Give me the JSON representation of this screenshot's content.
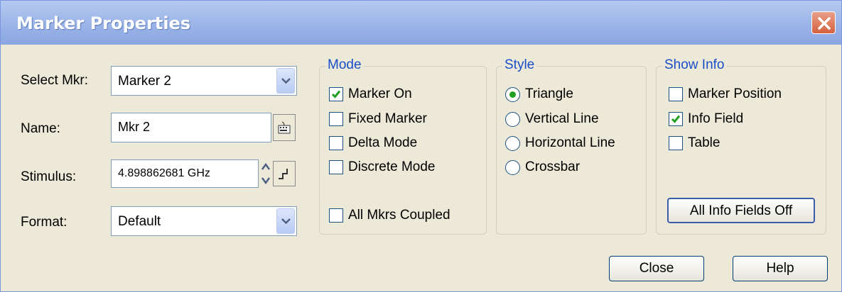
{
  "window": {
    "title": "Marker Properties"
  },
  "fields": {
    "select_mkr": {
      "label": "Select Mkr:",
      "value": "Marker 2"
    },
    "name": {
      "label": "Name:",
      "value": "Mkr 2"
    },
    "stimulus": {
      "label": "Stimulus:",
      "value": "4.898862681 GHz"
    },
    "format": {
      "label": "Format:",
      "value": "Default"
    }
  },
  "mode": {
    "legend": "Mode",
    "items": [
      {
        "label": "Marker On",
        "checked": true
      },
      {
        "label": "Fixed Marker",
        "checked": false
      },
      {
        "label": "Delta Mode",
        "checked": false
      },
      {
        "label": "Discrete Mode",
        "checked": false
      }
    ],
    "coupled": {
      "label": "All Mkrs Coupled",
      "checked": false
    }
  },
  "style": {
    "legend": "Style",
    "items": [
      {
        "label": "Triangle",
        "selected": true
      },
      {
        "label": "Vertical Line",
        "selected": false
      },
      {
        "label": "Horizontal Line",
        "selected": false
      },
      {
        "label": "Crossbar",
        "selected": false
      }
    ]
  },
  "show_info": {
    "legend": "Show Info",
    "items": [
      {
        "label": "Marker Position",
        "checked": false
      },
      {
        "label": "Info Field",
        "checked": true
      },
      {
        "label": "Table",
        "checked": false
      }
    ],
    "all_off_button": "All Info Fields Off"
  },
  "buttons": {
    "close": "Close",
    "help": "Help"
  },
  "colors": {
    "titlebar": "#9fb8ea",
    "legend": "#1a4ec8",
    "check": "#21a121",
    "dialog_bg": "#ece9d8"
  }
}
